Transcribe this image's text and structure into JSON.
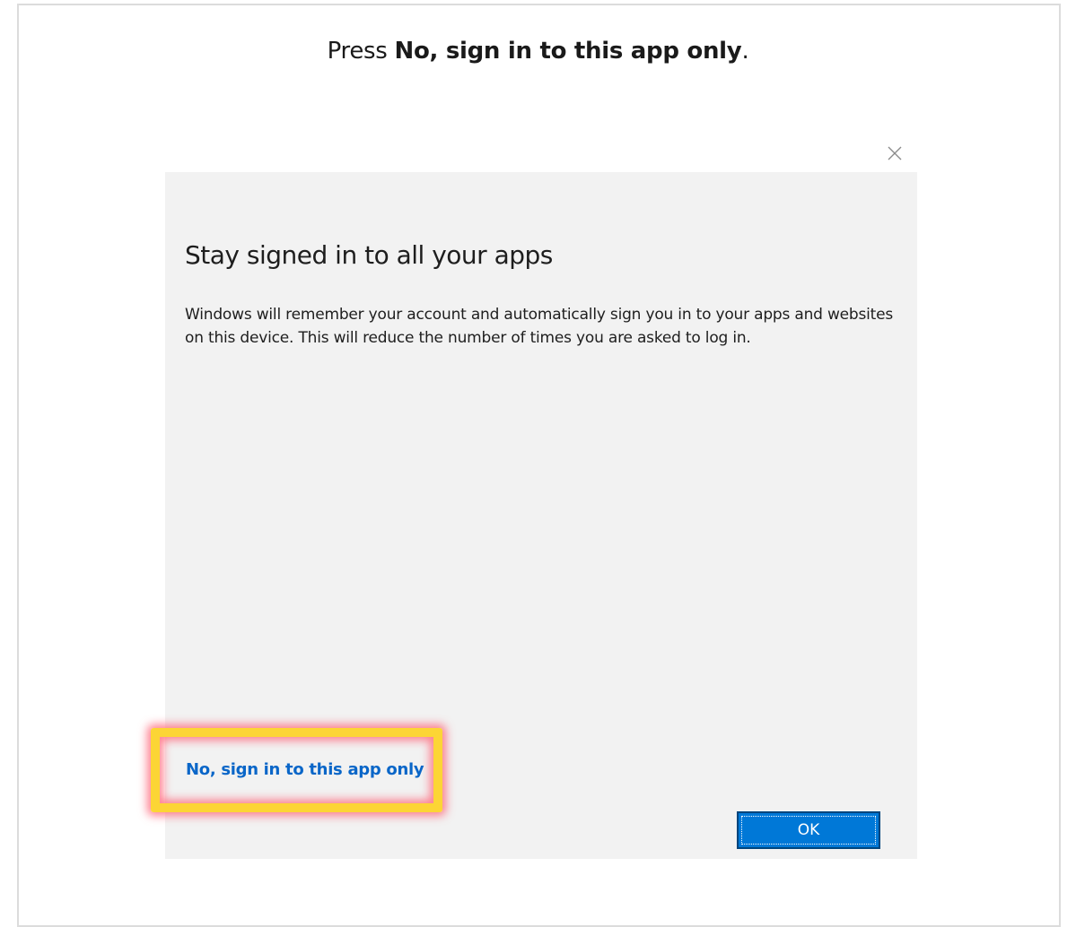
{
  "instruction": {
    "prefix": "Press ",
    "emphasis": "No, sign in to this app only",
    "suffix": "."
  },
  "dialog": {
    "title": "Stay signed in to all your apps",
    "body": "Windows will remember your account and automatically sign you in to your apps and websites on this device. This will reduce the number of times you are asked to log in.",
    "secondary_link": "No, sign in to this app only",
    "ok_label": "OK",
    "close_icon": "close-icon"
  },
  "colors": {
    "link": "#0a66c8",
    "ok_button": "#0078d7",
    "highlight": "#fcd535",
    "highlight_glow": "#ff5a6e",
    "dialog_bg": "#f2f2f2"
  }
}
